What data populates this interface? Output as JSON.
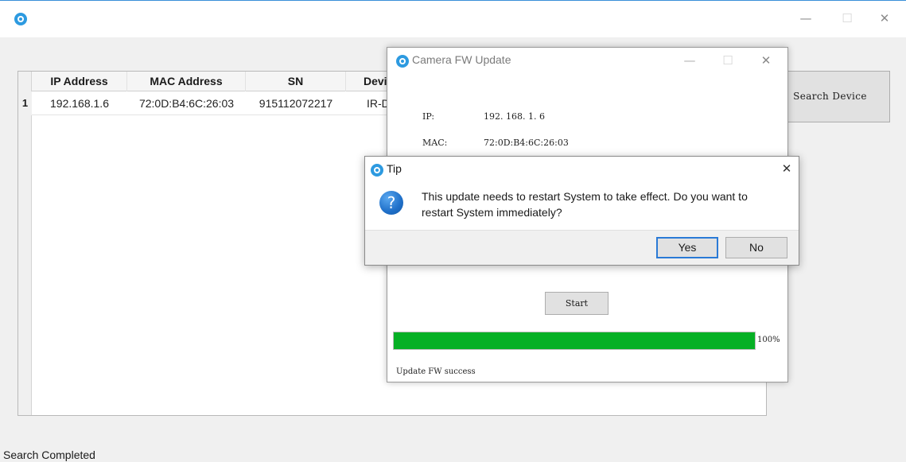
{
  "main_window": {
    "title_icon": "app-logo-icon",
    "controls": {
      "minimize": "—",
      "maximize": "☐",
      "close": "✕"
    }
  },
  "device_table": {
    "columns": [
      "IP Address",
      "MAC Address",
      "SN",
      "Devic"
    ],
    "rows": [
      {
        "index": "1",
        "ip": "192.168.1.6",
        "mac": "72:0D:B4:6C:26:03",
        "sn": "915112072217",
        "device": "IR-D"
      }
    ]
  },
  "search_button": {
    "label": "Search Device"
  },
  "status_bar": {
    "text": "Search Completed"
  },
  "fw_dialog": {
    "title": "Camera FW Update",
    "controls": {
      "minimize": "—",
      "maximize": "☐",
      "close": "✕"
    },
    "ip_label": "IP:",
    "ip_value": "192. 168. 1. 6",
    "mac_label": "MAC:",
    "mac_value": "72:0D:B4:6C:26:03",
    "start_label": "Start",
    "progress": {
      "value": 100,
      "label": "100%"
    },
    "status": "Update FW success",
    "progress_color": "#06b025"
  },
  "tip_dialog": {
    "title": "Tip",
    "close": "✕",
    "icon": "question-icon",
    "message": "This update needs to restart System to take effect. Do you want to restart System immediately?",
    "yes_label": "Yes",
    "no_label": "No"
  }
}
